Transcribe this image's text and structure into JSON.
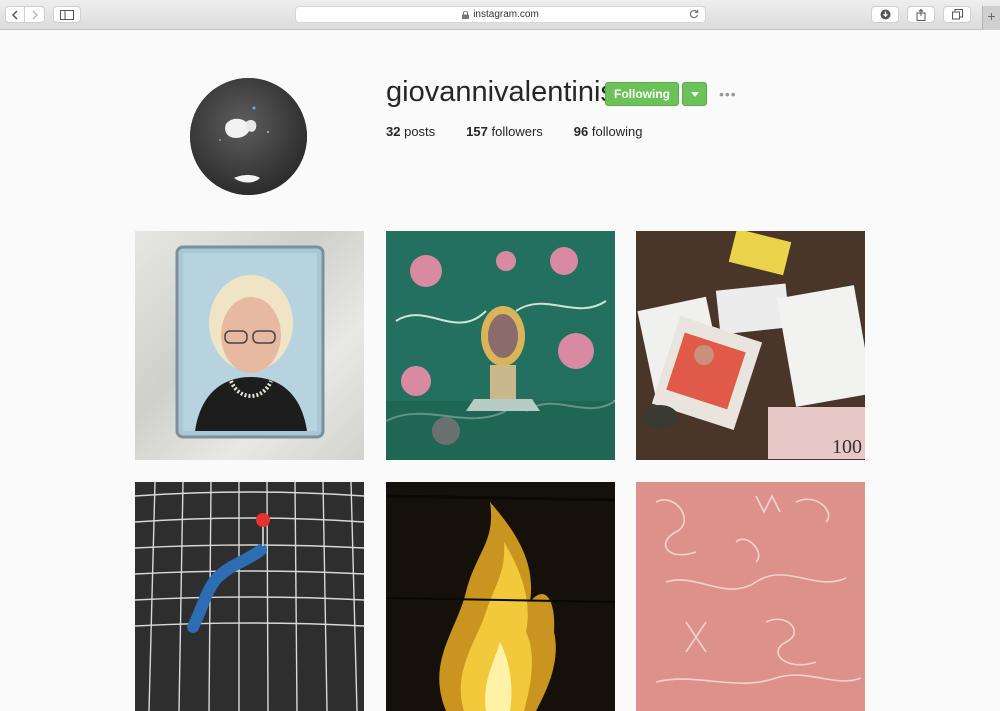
{
  "browser": {
    "url": "instagram.com",
    "icons": {
      "back": "chevron-left-icon",
      "forward": "chevron-right-icon",
      "sidebar": "sidebar-icon",
      "lock": "lock-icon",
      "reload": "reload-icon",
      "downloads": "download-icon",
      "share": "share-icon",
      "tabs": "tabs-icon",
      "new_tab": "plus-icon"
    }
  },
  "profile": {
    "username": "giovannivalentinis",
    "follow_button_label": "Following",
    "follow_button_color": "#6ac259",
    "more_label": "•••",
    "stats": {
      "posts_count": "32",
      "posts_label": "posts",
      "followers_count": "157",
      "followers_label": "followers",
      "following_count": "96",
      "following_label": "following"
    }
  },
  "posts": [
    {
      "subject": "portrait of elderly woman in frame"
    },
    {
      "subject": "religious icon on floral fabric"
    },
    {
      "subject": "photo, papers and banknote on table"
    },
    {
      "subject": "grid with red pin"
    },
    {
      "subject": "fire"
    },
    {
      "subject": "pink chalk scribbles"
    }
  ]
}
